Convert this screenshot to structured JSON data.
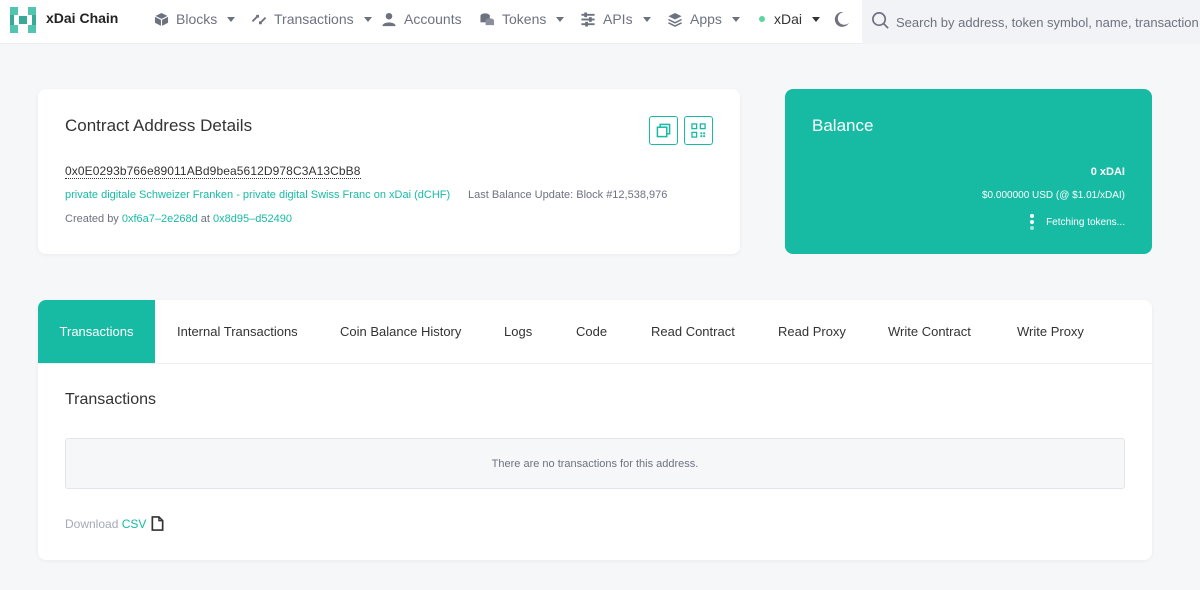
{
  "nav": {
    "brand": "xDai Chain",
    "items": [
      {
        "label": "Blocks",
        "icon": "cube-icon"
      },
      {
        "label": "Transactions",
        "icon": "transfer-icon"
      },
      {
        "label": "Accounts",
        "icon": "user-icon"
      },
      {
        "label": "Tokens",
        "icon": "coins-icon"
      },
      {
        "label": "APIs",
        "icon": "sliders-icon"
      },
      {
        "label": "Apps",
        "icon": "layers-icon"
      }
    ],
    "network": "xDai",
    "search_placeholder": "Search by address, token symbol, name, transaction hash, or block number"
  },
  "details": {
    "title": "Contract Address Details",
    "address": "0x0E0293b766e89011ABd9bea5612D978C3A13CbB8",
    "token_link": "private digitale Schweizer Franken - private digital Swiss Franc on xDai (dCHF)",
    "last_update": "Last Balance Update: Block #12,538,976",
    "created_prefix": "Created by",
    "creator": "0xf6a7–2e268d",
    "created_at_word": "at",
    "creation_tx": "0x8d95–d52490"
  },
  "balance": {
    "title": "Balance",
    "amount": "0 xDAI",
    "usd": "$0.000000 USD (@ $1.01/xDAI)",
    "fetching": "Fetching tokens..."
  },
  "tabs": [
    "Transactions",
    "Internal Transactions",
    "Coin Balance History",
    "Logs",
    "Code",
    "Read Contract",
    "Read Proxy",
    "Write Contract",
    "Write Proxy"
  ],
  "transactions": {
    "title": "Transactions",
    "empty": "There are no transactions for this address.",
    "download_prefix": "Download",
    "download_link": "CSV"
  },
  "colors": {
    "accent": "#17bba4",
    "nav_text": "#6d7280",
    "network_dot": "#5fd3a0"
  }
}
